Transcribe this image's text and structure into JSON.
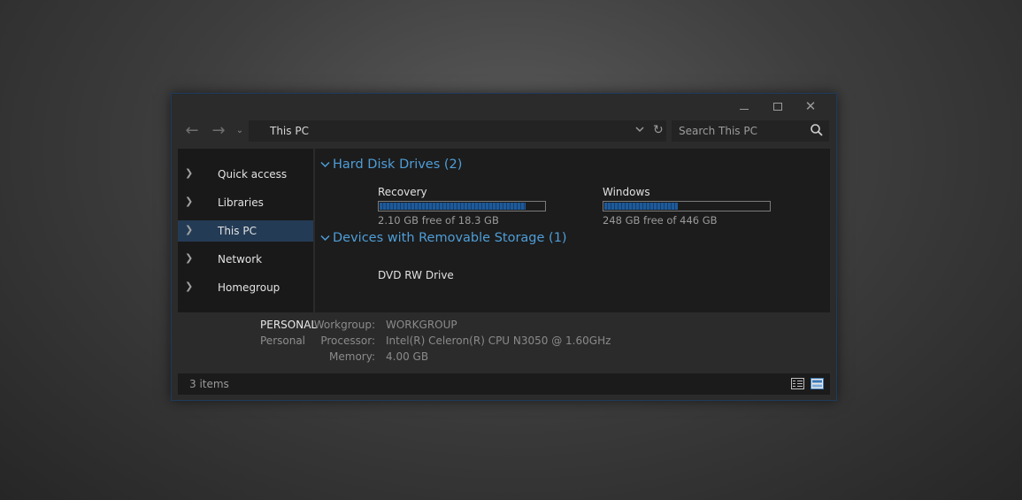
{
  "window": {
    "controls": {
      "minimize": "minimize",
      "maximize": "maximize",
      "close": "✕"
    }
  },
  "nav": {
    "address": "This PC",
    "search_placeholder": "Search This PC"
  },
  "sidebar": {
    "items": [
      {
        "label": "Quick access",
        "selected": false
      },
      {
        "label": "Libraries",
        "selected": false
      },
      {
        "label": "This PC",
        "selected": true
      },
      {
        "label": "Network",
        "selected": false
      },
      {
        "label": "Homegroup",
        "selected": false
      }
    ]
  },
  "content": {
    "groups": [
      {
        "title": "Hard Disk Drives (2)",
        "drives": [
          {
            "name": "Recovery",
            "free_text": "2.10 GB free of 18.3 GB",
            "used_fraction": 0.885
          },
          {
            "name": "Windows",
            "free_text": "248 GB free of 446 GB",
            "used_fraction": 0.444
          }
        ]
      },
      {
        "title": "Devices with Removable Storage (1)",
        "devices": [
          {
            "name": "DVD RW Drive"
          }
        ]
      }
    ]
  },
  "details": {
    "computer_name": "PERSONAL",
    "computer_desc": "Personal",
    "workgroup_label": "Workgroup:",
    "workgroup_value": "WORKGROUP",
    "processor_label": "Processor:",
    "processor_value": "Intel(R) Celeron(R) CPU  N3050  @ 1.60GHz",
    "memory_label": "Memory:",
    "memory_value": "4.00 GB"
  },
  "status": {
    "items_text": "3 items"
  },
  "colors": {
    "accent": "#4e9ed8",
    "selection": "#243b55",
    "drive_fill": "#1e5a9a",
    "window_border": "#1d3a5c"
  }
}
